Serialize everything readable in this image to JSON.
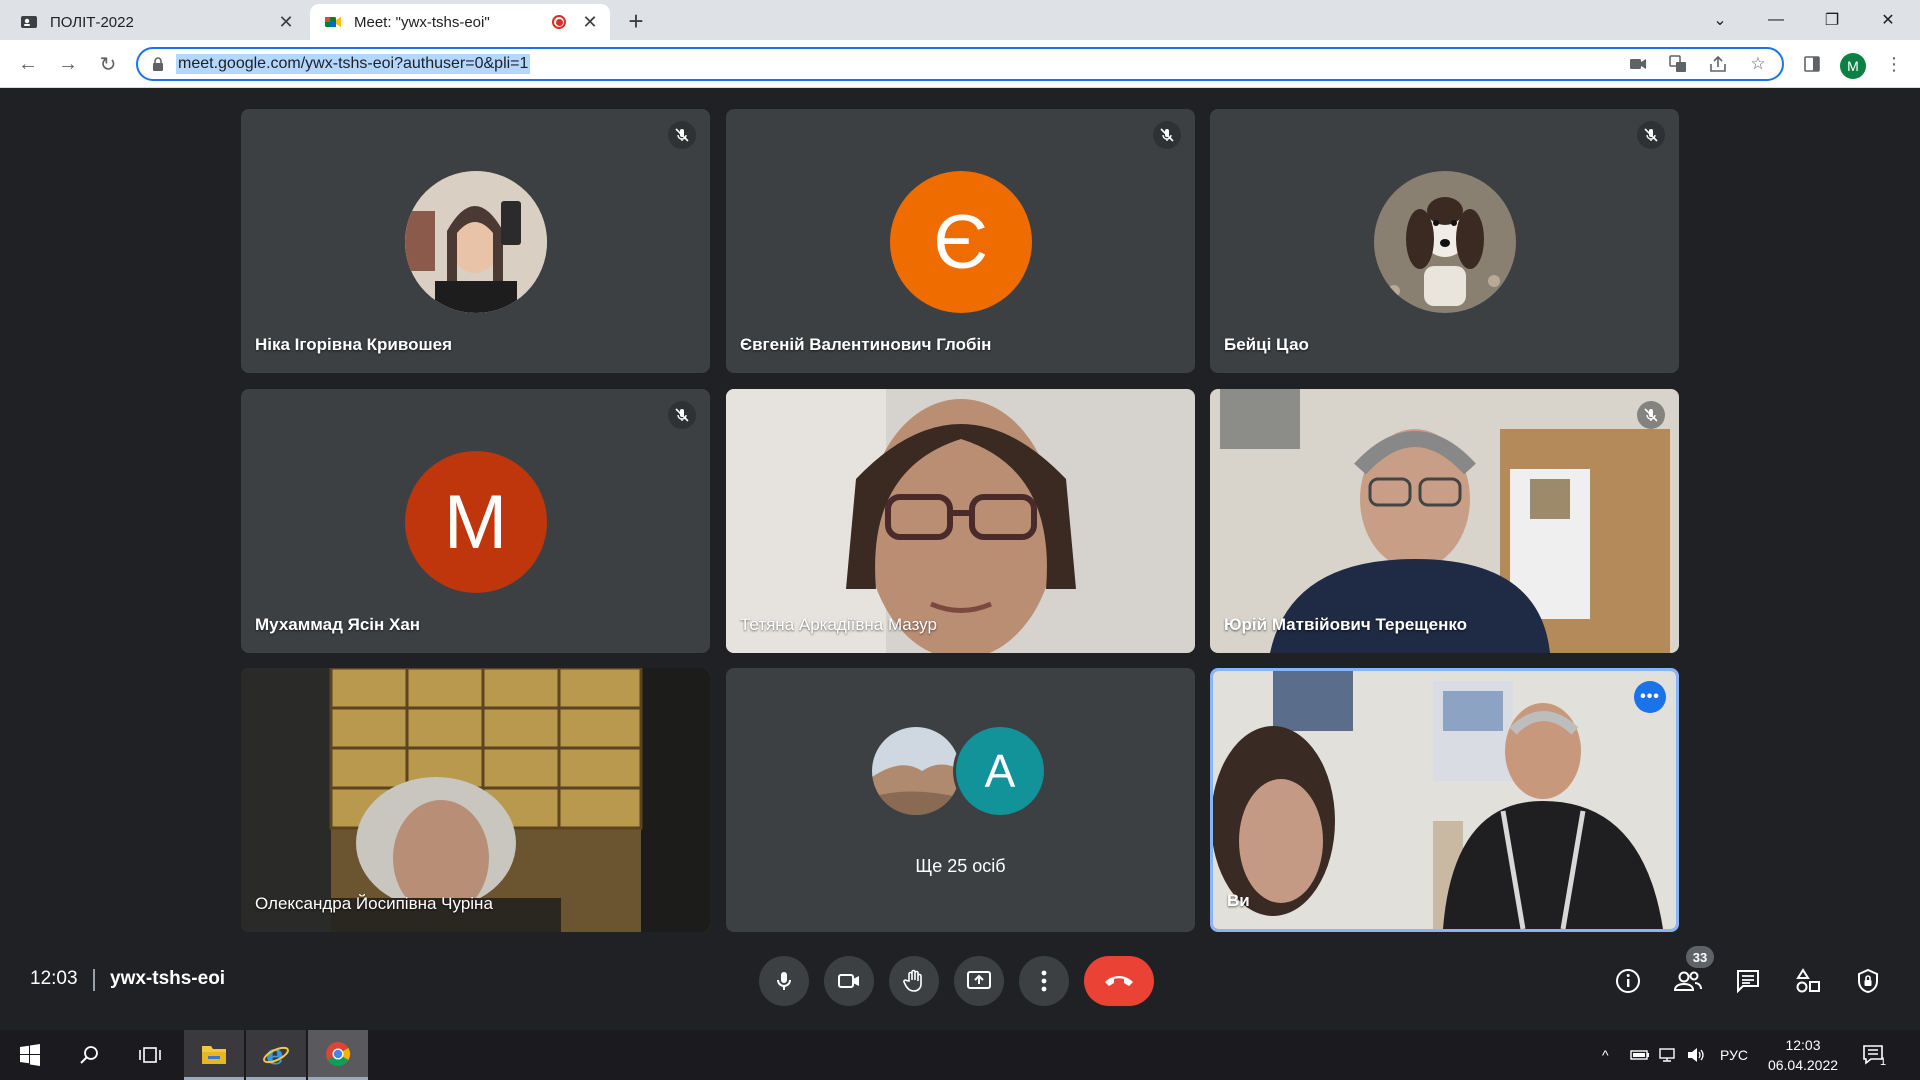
{
  "browser": {
    "tabs": [
      {
        "title": "ПОЛІТ-2022"
      },
      {
        "title": "Meet: \"ywx-tshs-eoi\""
      }
    ],
    "url": "meet.google.com/ywx-tshs-eoi?authuser=0&pli=1",
    "profile_initial": "M"
  },
  "participants": [
    {
      "name": "Ніка Ігорівна Кривошея",
      "kind": "photo"
    },
    {
      "name": "Євгеній Валентинович Глобін",
      "kind": "letter",
      "letter": "Є",
      "color": "#ef6c00"
    },
    {
      "name": "Бейці Цао",
      "kind": "photo"
    },
    {
      "name": "Мухаммад Ясін Хан",
      "kind": "letter",
      "letter": "M",
      "color": "#bf360c"
    },
    {
      "name": "Тетяна Аркадіївна Мазур",
      "kind": "video"
    },
    {
      "name": "Юрій Матвійович Терещенко",
      "kind": "video"
    },
    {
      "name": "Олександра Йосипівна Чуріна",
      "kind": "video"
    },
    {
      "name": "Ще 25 осіб",
      "kind": "others",
      "letter": "A",
      "color": "#12939a"
    },
    {
      "name": "Ви",
      "kind": "self"
    }
  ],
  "meeting": {
    "time": "12:03",
    "code": "ywx-tshs-eoi",
    "participant_count": "33"
  },
  "taskbar": {
    "language": "РУС",
    "time": "12:03",
    "date": "06.04.2022",
    "notification_count": "1"
  },
  "colors": {
    "meet_bg": "#202124",
    "tile_bg": "#3c4043",
    "end_call": "#ea4335",
    "accent": "#1a73e8"
  }
}
